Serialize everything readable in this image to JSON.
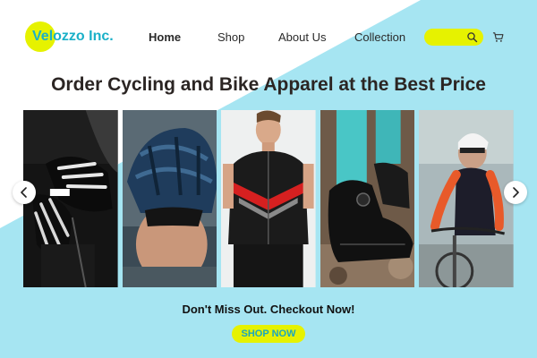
{
  "brand": {
    "name": "Velozzo Inc."
  },
  "nav": {
    "home": "Home",
    "shop": "Shop",
    "about": "About Us",
    "collection": "Collection"
  },
  "search": {
    "placeholder": ""
  },
  "icons": {
    "search": "search-icon",
    "cart": "cart-icon",
    "prev": "chevron-left-icon",
    "next": "chevron-right-icon"
  },
  "hero": {
    "headline": "Order Cycling and Bike Apparel at the Best Price"
  },
  "gallery": {
    "items": [
      {
        "subject": "cycling gloves"
      },
      {
        "subject": "cycling helmet"
      },
      {
        "subject": "cycling jersey"
      },
      {
        "subject": "cycling shoes"
      },
      {
        "subject": "road cyclist"
      }
    ]
  },
  "cta": {
    "text": "Don't Miss Out. Checkout Now!",
    "button": "SHOP NOW"
  },
  "colors": {
    "accent_yellow": "#e6f200",
    "accent_cyan": "#a6e5f2",
    "brand_text": "#1ab0c8",
    "headline": "#2b2523"
  }
}
